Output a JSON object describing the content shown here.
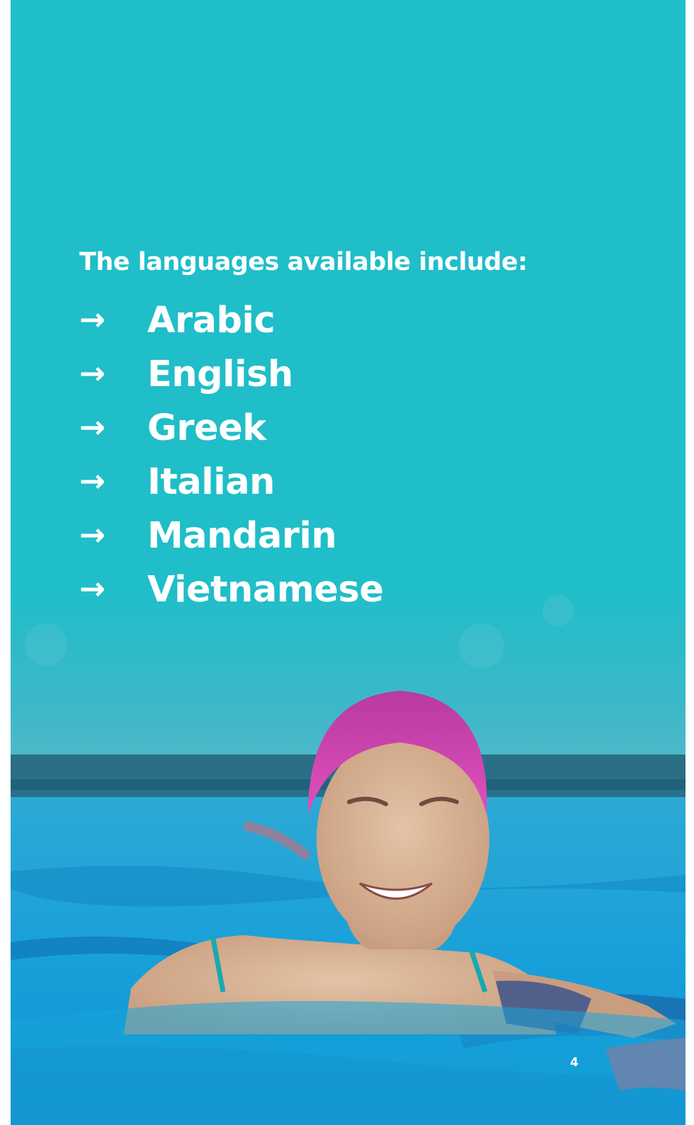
{
  "intro_text": "The languages available include:",
  "bullet_glyph": "→",
  "languages": [
    {
      "label": "Arabic"
    },
    {
      "label": "English"
    },
    {
      "label": "Greek"
    },
    {
      "label": "Italian"
    },
    {
      "label": "Mandarin"
    },
    {
      "label": "Vietnamese"
    }
  ],
  "page_number": "4",
  "colors": {
    "background": "#1fbec9",
    "text": "#ffffff",
    "pool_water": "#1aa3d6",
    "swim_cap": "#e048b8"
  }
}
